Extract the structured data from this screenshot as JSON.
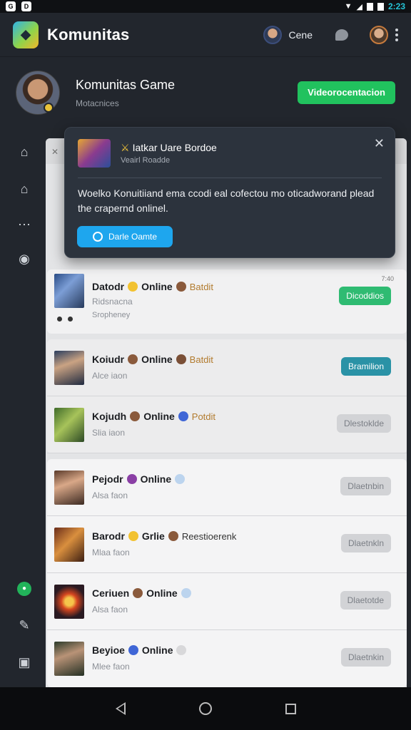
{
  "status_bar": {
    "time": "2:23"
  },
  "app": {
    "title": "Komunitas",
    "user_name": "Cene"
  },
  "profile": {
    "name": "Komunitas Game",
    "subtitle": "Motacnices",
    "action_label": "Videorocentacion"
  },
  "popup": {
    "title": "Iatkar Uare Bordoe",
    "subtitle": "Veairl Roadde",
    "body": "Woelko Konuitiiand ema ccodi eal cofectou mo oticadworand plead the crapernd onlinel.",
    "button_label": "Darle Oamte"
  },
  "list": [
    {
      "name": "Datodr",
      "status": "Online",
      "tag": "Batdit",
      "sub": "Ridsnacna",
      "sub2": "Sropheney",
      "button": "Dicoddios",
      "button_style": "green",
      "time": "7:40"
    },
    {
      "name": "Koiudr",
      "status": "Online",
      "tag": "Batdit",
      "sub": "Alce iaon",
      "button": "Bramilion",
      "button_style": "teal"
    },
    {
      "name": "Kojudh",
      "status": "Online",
      "tag": "Potdit",
      "sub": "Slia iaon",
      "button": "Dlestoklde",
      "button_style": "grey"
    },
    {
      "name": "Pejodr",
      "status": "Online",
      "tag": "",
      "sub": "Alsa faon",
      "button": "Dlaetnbin",
      "button_style": "grey"
    },
    {
      "name": "Barodr",
      "status": "Grlie",
      "tag": "Reestioerenk",
      "sub": "Mlaa faon",
      "button": "Dlaetnkln",
      "button_style": "grey"
    },
    {
      "name": "Ceriuen",
      "status": "Online",
      "tag": "",
      "sub": "Alsa faon",
      "button": "Dlaetotde",
      "button_style": "grey"
    },
    {
      "name": "Beyioe",
      "status": "Online",
      "tag": "",
      "sub": "Mlee faon",
      "button": "Dlaetnkin",
      "button_style": "grey"
    }
  ]
}
